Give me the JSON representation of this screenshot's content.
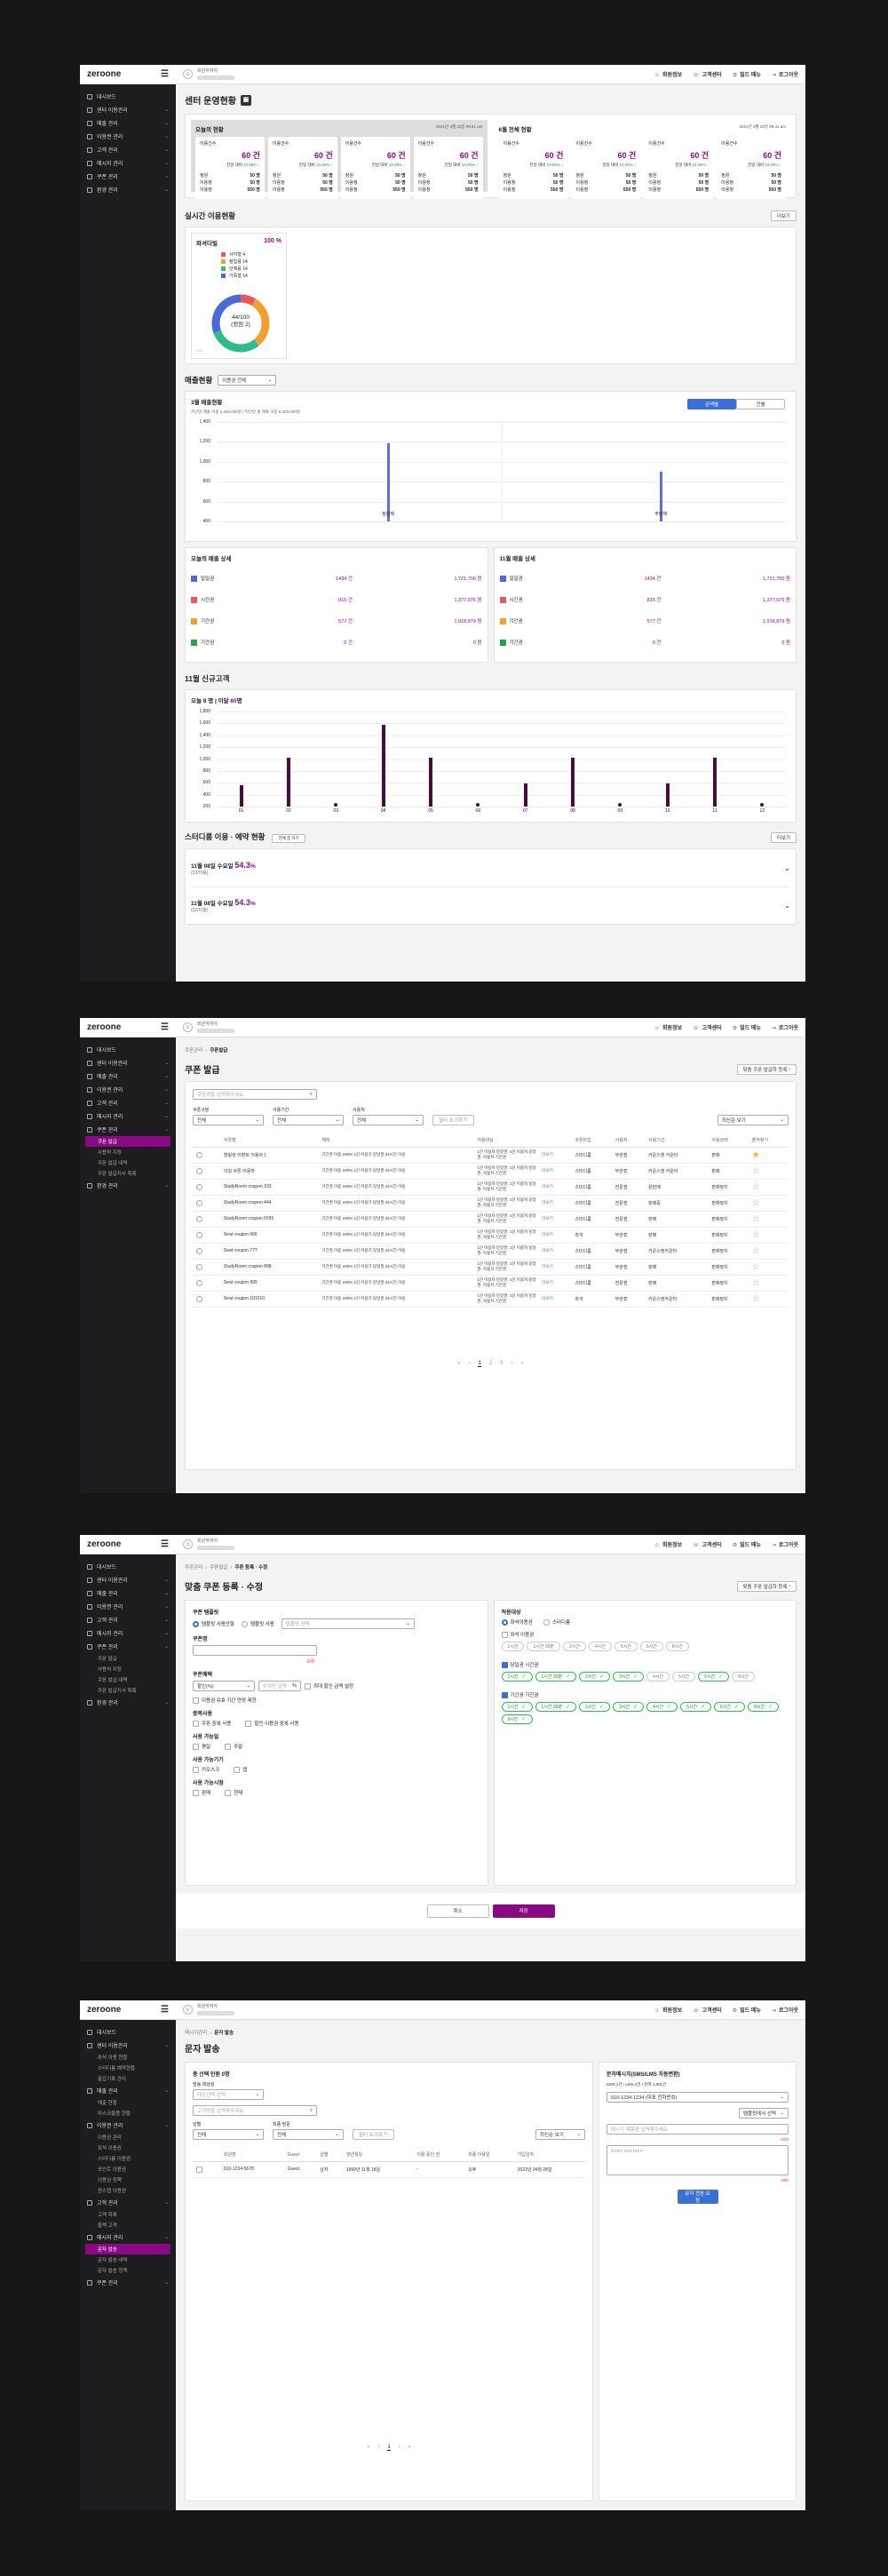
{
  "app": {
    "brand": "zeroone",
    "user_label": "회원하여야",
    "top_links": [
      "회원정보",
      "고객센터",
      "빌드 메뉴",
      "로그아웃"
    ]
  },
  "sidebar1": {
    "items": [
      {
        "label": "대시보드"
      },
      {
        "label": "센터 이용관리"
      },
      {
        "label": "매출 관리"
      },
      {
        "label": "이용권 관리"
      },
      {
        "label": "고객 관리"
      },
      {
        "label": "메시지 관리"
      },
      {
        "label": "쿠폰 관리"
      },
      {
        "label": "환경 관리"
      }
    ]
  },
  "screen1": {
    "title": "센터 운영현황",
    "today_title": "오늘의 현황",
    "month_title": "6월 전체 현황",
    "timestamp": "2021년 3월 23일 09:41 am",
    "card": {
      "label": "이용건수",
      "value": "60 건",
      "compare": "전일 대비",
      "pct": "10.06%",
      "r1": "정원",
      "v1": "50 명",
      "r2": "이용정",
      "v2": "50 명",
      "r3": "이용정",
      "v3": "550 명"
    },
    "realtime_title": "실시간 이용현황",
    "more": "더보기",
    "pie_title": "파셔더빌",
    "pie_total": "100 %",
    "pie_center1": "44/100",
    "pie_center2": "(정원 2)",
    "pie_legend": [
      "사각형 4",
      "창업용 14",
      "단체용 14",
      "가족형 14"
    ],
    "sales_title": "매출현황",
    "sales_select": "이용권 전체",
    "march_title": "3월 매출현황",
    "march_sub": "지난달 매출 이용 3,400,000원 / 이번달 총 매출 이용 5,000,000원",
    "toggle_a": "금액별",
    "toggle_b": "건별",
    "today_detail": "오늘의 매출 상세",
    "nov_detail": "11월 매출 상세",
    "detail_rows": [
      {
        "name": "일일권",
        "count": "1434 건",
        "amount": "1,721,700 원",
        "color": "#4a6ad8"
      },
      {
        "name": "시간권",
        "count": "815 건",
        "amount": "1,377,076 원",
        "color": "#e8585a"
      },
      {
        "name": "기간권",
        "count": "577 건",
        "amount": "1,918,879 원",
        "color": "#f0a030"
      },
      {
        "name": "기간권",
        "count": "0 건",
        "amount": "0 원",
        "color": "#28a050"
      }
    ],
    "new_title": "11월 신규고객",
    "new_sub_a": "오늘 8",
    "new_sub_b": "명 | 이달",
    "new_sub_c": "80",
    "new_sub_d": "명",
    "study_title": "스터디룸 이용 · 예약 현황",
    "study_tag": "전체 룸 하기",
    "study_rows": [
      {
        "date": "11월 08일 수요일",
        "pct": "54.3",
        "unit": "%",
        "sub": "(22/이용)"
      },
      {
        "date": "11월 08일 수요일",
        "pct": "54.3",
        "unit": "%",
        "sub": "(22/이용)"
      }
    ]
  },
  "chart_data": [
    {
      "type": "bar",
      "title": "3월 매출현황",
      "categories": [
        "정원제",
        "주판제"
      ],
      "values": [
        1100,
        700
      ],
      "ylim": [
        400,
        1400
      ],
      "yticks": [
        "1,400",
        "1,200",
        "1,000",
        "800",
        "600",
        "400"
      ]
    },
    {
      "type": "bar",
      "title": "11월 신규고객",
      "categories": [
        "01",
        "02",
        "03",
        "04",
        "05",
        "06",
        "07",
        "08",
        "09",
        "10",
        "11",
        "12"
      ],
      "values": [
        450,
        1020,
        0,
        1720,
        1020,
        0,
        480,
        1020,
        0,
        480,
        1020,
        0
      ],
      "ylim": [
        200,
        2000
      ],
      "yticks": [
        "1,800",
        "1,600",
        "1,400",
        "1,200",
        "1,000",
        "800",
        "600",
        "400",
        "200"
      ]
    }
  ],
  "sidebar2": {
    "items": [
      {
        "label": "대시보드"
      },
      {
        "label": "센터 이용관리"
      },
      {
        "label": "매출 관리"
      },
      {
        "label": "이용권 관리"
      },
      {
        "label": "고객 관리"
      },
      {
        "label": "메시지 관리"
      },
      {
        "label": "쿠폰 관리"
      }
    ],
    "subs": [
      "쿠폰 발급",
      "사용처 지정",
      "쿠폰 발급 내역",
      "쿠폰 발급지사 목록"
    ],
    "last": "환경 관리"
  },
  "screen2": {
    "crumb_a": "쿠폰관리",
    "crumb_b": "쿠폰발급",
    "title": "쿠폰 발급",
    "action": "맞춤 쿠폰 발급하 등록",
    "search_placeholder": "쿠폰명을 입력해주세요",
    "f1": "쿠폰구분",
    "f2": "사용기간",
    "f3": "사용처",
    "all": "전체",
    "reset": "필터 초기화",
    "sort": "최신순 보기",
    "headers": [
      "",
      "쿠폰명",
      "혜택",
      "적용대상",
      "쿠폰타입",
      "사용처",
      "사용기간",
      "사용상태",
      "즐겨찾기"
    ],
    "rows": [
      {
        "name": "힐링권 이벤트 이용자 1",
        "benefit": "기간권 이용 100% 1인 이용기 당일권 24시간 이용",
        "target": "1인 이용자 당일권, 1인 이용자 당일권, 이용자 기간권",
        "more": "더보기",
        "type": "스터디룸",
        "place": "무관점",
        "period": "카운스엔 카운터",
        "state": "판매",
        "star": true
      },
      {
        "name": "이일 쿠폰 이용하",
        "benefit": "기간권 이용 100% 1인 이용기 당일권 24시간 이용",
        "target": "1인 이용자 당일권, 1인 이용자 당일권, 이용자 기간권",
        "more": "더보기",
        "type": "스터디룸",
        "place": "무관점",
        "period": "카운스엔 카운터",
        "state": "판매",
        "star": false
      },
      {
        "name": "StudyRoom coupon 333",
        "benefit": "기간권 이용 100% 1인 이용기 당일권 24시간 이용",
        "target": "1인 이용자 당일권, 1인 이용자 당일권, 이용자 기간권",
        "more": "더보기",
        "type": "스터디룸",
        "place": "전문점",
        "period": "원판매",
        "state": "판매정지",
        "star": false
      },
      {
        "name": "StudyRoom coupon 444",
        "benefit": "기간권 이용 100% 1인 이용기 당일권 24시간 이용",
        "target": "1인 이용자 당일권, 1인 이용자 당일권, 이용자 기간권",
        "more": "더보기",
        "type": "스터디룸",
        "place": "전문점",
        "period": "판매중",
        "state": "판매정지",
        "star": false
      },
      {
        "name": "StudyRoom coupon 5555",
        "benefit": "기간권 이용 100% 1인 이용기 당일권 24시간 이용",
        "target": "1인 이용자 당일권, 1인 이용자 당일권, 이용자 기간권",
        "more": "더보기",
        "type": "스터디룸",
        "place": "전문점",
        "period": "판매",
        "state": "판매정지",
        "star": false
      },
      {
        "name": "Seat coupon 666",
        "benefit": "기간권 이용 100% 1인 이용기 당일권 24시간 이용",
        "target": "1인 이용자 당일권, 1인 이용자 당일권, 이용자 기간권",
        "more": "더보기",
        "type": "좌석",
        "place": "무관점",
        "period": "판매",
        "state": "판매정지",
        "star": false
      },
      {
        "name": "Seat coupon 777",
        "benefit": "기간권 이용 100% 1인 이용기 당일권 24시간 이용",
        "target": "1인 이용자 당일권, 1인 이용자 당일권, 이용자 기간권",
        "more": "더보기",
        "type": "스터디룸",
        "place": "무관점",
        "period": "카운스엔카운터",
        "state": "판매정지",
        "star": false
      },
      {
        "name": "StudyRoom coupon 888",
        "benefit": "기간권 이용 100% 1인 이용기 당일권 24시간 이용",
        "target": "1인 이용자 당일권, 1인 이용자 당일권, 이용자 기간권",
        "more": "더보기",
        "type": "스터디룸",
        "place": "무관점",
        "period": "판매",
        "state": "판매정지",
        "star": false
      },
      {
        "name": "Seat coupon 999",
        "benefit": "기간권 이용 100% 1인 이용기 당일권 24시간 이용",
        "target": "1인 이용자 당일권, 1인 이용자 당일권, 이용자 기간권",
        "more": "더보기",
        "type": "스터디룸",
        "place": "전문점",
        "period": "판매",
        "state": "판매정지",
        "star": false
      },
      {
        "name": "Seat coupon 101010",
        "benefit": "기간권 이용 100% 1인 이용기 당일권 24시간 이용",
        "target": "1인 이용자 당일권, 1인 이용자 당일권, 이용자 기간권",
        "more": "더보기",
        "type": "좌석",
        "place": "무관점",
        "period": "카운스엔카운터",
        "state": "판매정지",
        "star": false
      }
    ],
    "pages": [
      "1",
      "2",
      "3"
    ]
  },
  "screen3": {
    "crumb_a": "쿠폰관리",
    "crumb_b": "쿠폰발급",
    "crumb_c": "쿠폰 등록 · 수정",
    "title": "맞춤 쿠폰 등록 · 수정",
    "action": "맞춤 쿠폰 발급하 등록",
    "l_type": "쿠폰 템플릿",
    "r_new": "템플릿 사용안함",
    "r_tpl": "템플릿 사용",
    "tpl_ph": "템플릿 선택",
    "l_name": "쿠폰명",
    "err": "오류",
    "l_benefit": "쿠폰혜택",
    "benefit_sel": "할인(%)",
    "benefit_ph": "숫자만 입력",
    "benefit_unit": "%",
    "benefit_chk": "최대 할인 금액 설정",
    "benefit_chk2": "이용권 유효 기간 연장 제한",
    "l_dup": "중복사용",
    "dup_a": "쿠폰 중복 사용",
    "dup_b": "할인 이용권 중복 사용",
    "l_avail": "사용 가능일",
    "avail_a": "평일",
    "avail_b": "주말",
    "l_period": "사용 가능기기",
    "period_a": "키오스크",
    "period_b": "앱",
    "l_place": "사용 가능시점",
    "place_a": "판매",
    "place_b": "현재",
    "r_title": "적용대상",
    "r_a": "좌석이용권",
    "r_b": "스터디룸",
    "chk_all": "좌석 이용권",
    "pills1": [
      "1시간",
      "1시간 30분",
      "2시간",
      "4시간",
      "5시간",
      "6시간",
      "8시간"
    ],
    "chk_time": "당일권 시간권",
    "pills2": [
      "1시간",
      "1시간 30분",
      "2시간",
      "3시간",
      "4시간",
      "5시간",
      "6시간",
      "8시간"
    ],
    "chk_period": "기간권 기간권",
    "pills3": [
      "1시간",
      "1시간 30분",
      "2시간",
      "3시간",
      "4시간",
      "5시간",
      "6시간",
      "8시간",
      "9시간"
    ],
    "cancel": "취소",
    "save": "저장"
  },
  "sidebar4": {
    "items": [
      {
        "label": "대시보드",
        "subs": []
      },
      {
        "label": "센터 이용관리",
        "subs": [
          "좌석 이용 현황",
          "스터디룸 예약현황",
          "출입기록 관리"
        ]
      },
      {
        "label": "매출 관리",
        "subs": [
          "매출 현황",
          "마스크물품 현황"
        ]
      },
      {
        "label": "이용권 관리",
        "subs": [
          "이용권 관리",
          "좌석 이용권",
          "스터디룸 이용권",
          "포인트 이용권",
          "이용권 정책",
          "원스탭 이용권"
        ]
      },
      {
        "label": "고객 관리",
        "subs": [
          "고객 목록",
          "블랙 고객"
        ]
      },
      {
        "label": "메시지 관리",
        "subs": [
          "문자 발송",
          "문자 발송 내역",
          "문자 발송 정책"
        ]
      },
      {
        "label": "쿠폰 관리",
        "subs": []
      }
    ]
  },
  "screen4": {
    "crumb_a": "메시지관리",
    "crumb_b": "문자 발송",
    "title": "문자 발송",
    "sel_title": "총 선택 인원 0명",
    "target_lbl": "발송 대상설",
    "target_ph": "대상선택 선택",
    "search_ph": "고객명을 입력해주세요",
    "f1": "성별",
    "f2": "최종 방문",
    "all": "전체",
    "reset": "필터 초기화",
    "sort": "최신순 보기",
    "headers": [
      "",
      "회원명",
      "Guest",
      "성별",
      "생년월일",
      "이용 중인 권",
      "최종 이용일",
      "가입일자"
    ],
    "rows": [
      {
        "phone": "010-1234-5678",
        "guest": "Guest",
        "gender": "남자",
        "birth": "1999년 11월 18일",
        "pass": "-",
        "last": "오후",
        "join": "2022년 04월 28일"
      }
    ],
    "pages": [
      "1"
    ],
    "r_title": "문자메시지(SMS/LMS 자동변환)",
    "r_desc": "SMS 2건 / LMS 2건 / 잔여 1,001건",
    "from_sel": "010-1234-1234 (대표 전화번호)",
    "btn_tpl": "템플릿에서 선택",
    "subject_ph": "메시지 제목을 입력해주세요",
    "err1": "0/20",
    "body_ph": "Enter text here",
    "err2": "0/80",
    "send": "문자 전송 요청"
  }
}
